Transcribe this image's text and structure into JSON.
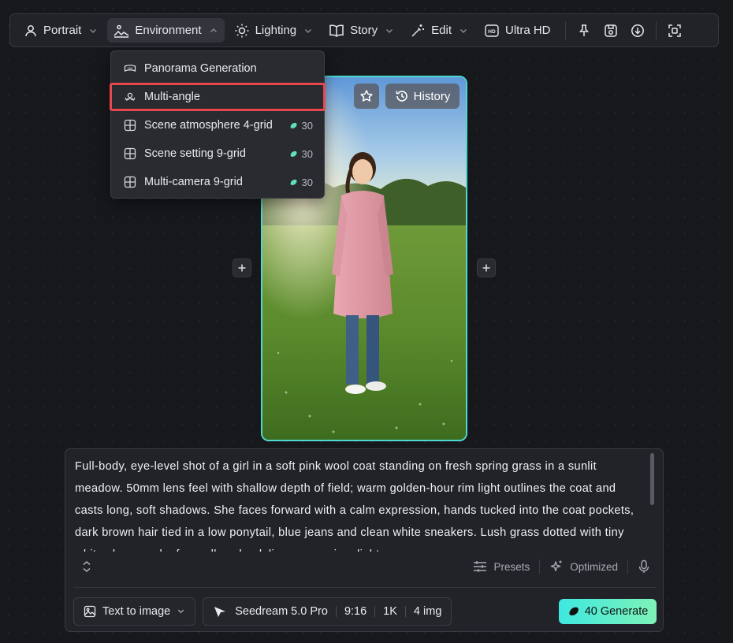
{
  "toolbar": {
    "portrait": "Portrait",
    "environment": "Environment",
    "lighting": "Lighting",
    "story": "Story",
    "edit": "Edit",
    "ultra_hd": "Ultra HD"
  },
  "dropdown": {
    "items": [
      {
        "label": "Panorama Generation",
        "cost": ""
      },
      {
        "label": "Multi-angle",
        "cost": ""
      },
      {
        "label": "Scene atmosphere 4-grid",
        "cost": "30"
      },
      {
        "label": "Scene setting 9-grid",
        "cost": "30"
      },
      {
        "label": "Multi-camera 9-grid",
        "cost": "30"
      }
    ]
  },
  "card": {
    "history": "History"
  },
  "prompt": {
    "text": "Full-body, eye-level shot of a girl in a soft pink wool coat standing on fresh spring grass in a sunlit meadow. 50mm lens feel with shallow depth of field; warm golden-hour rim light outlines the coat and casts long, soft shadows. She faces forward with a calm expression, hands tucked into the coat pockets, dark brown hair tied in a low ponytail, blue jeans and clean white sneakers. Lush grass dotted with tiny white clover and a few yellow dandelions sways in a light",
    "presets": "Presets",
    "optimized": "Optimized"
  },
  "bottom": {
    "mode": "Text to image",
    "model": "Seedream 5.0 Pro",
    "ratio": "9:16",
    "resolution": "1K",
    "count": "4 img",
    "generate": "40 Generate"
  },
  "colors": {
    "accent": "#4fd7d0",
    "highlight": "#e5484d",
    "generate_start": "#3ee8e0",
    "generate_end": "#7ff2b8"
  }
}
